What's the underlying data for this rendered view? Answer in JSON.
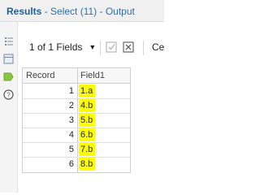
{
  "window": {
    "title_bold": "Results",
    "title_rest": " - Select (11) - Output"
  },
  "sidebar": {
    "icons": [
      "list-icon",
      "table-icon",
      "tag-icon",
      "help-icon"
    ]
  },
  "toolbar": {
    "fields_selector": "1 of 1 Fields",
    "cut_label": "Ce"
  },
  "grid": {
    "columns": [
      "Record",
      "Field1"
    ],
    "rows": [
      {
        "record": "1",
        "field1": "1.a"
      },
      {
        "record": "2",
        "field1": "4.b"
      },
      {
        "record": "3",
        "field1": "5.b"
      },
      {
        "record": "4",
        "field1": "6.b"
      },
      {
        "record": "5",
        "field1": "7.b"
      },
      {
        "record": "6",
        "field1": "8.b"
      }
    ]
  },
  "colors": {
    "highlight": "#ffff00",
    "title": "#2f6fa8",
    "active_icon": "#8cc63f"
  }
}
